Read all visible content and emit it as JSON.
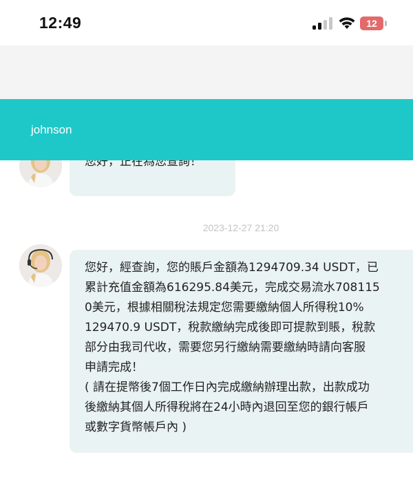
{
  "status_bar": {
    "time": "12:49",
    "battery_level": "12",
    "signal_icon": "cellular-signal-icon",
    "wifi_icon": "wifi-icon",
    "battery_icon": "battery-icon"
  },
  "header": {
    "username": "johnson",
    "accent_color": "#1ec8c8"
  },
  "messages": [
    {
      "sender": "agent",
      "text": "您好，正在為您查詢！"
    },
    {
      "timestamp": "2023-12-27 21:20"
    },
    {
      "sender": "agent",
      "lines": [
        "您好，經查詢，您的賬戶金額為1294709.34 USDT，已",
        "累計充值金額為616295.84美元，完成交易流水708115",
        "0美元，根據相關稅法規定您需要繳納個人所得稅10%",
        "129470.9 USDT，稅款繳納完成後即可提款到賬，稅款",
        "部分由我司代收，需要您另行繳納需要繳納時請向客服",
        "申請完成！",
        "( 請在提幣後7個工作日內完成繳納辦理出款，出款成功",
        "後繳納其個人所得稅將在24小時內退回至您的銀行帳戶",
        "或數字貨幣帳戶內 )"
      ]
    }
  ]
}
